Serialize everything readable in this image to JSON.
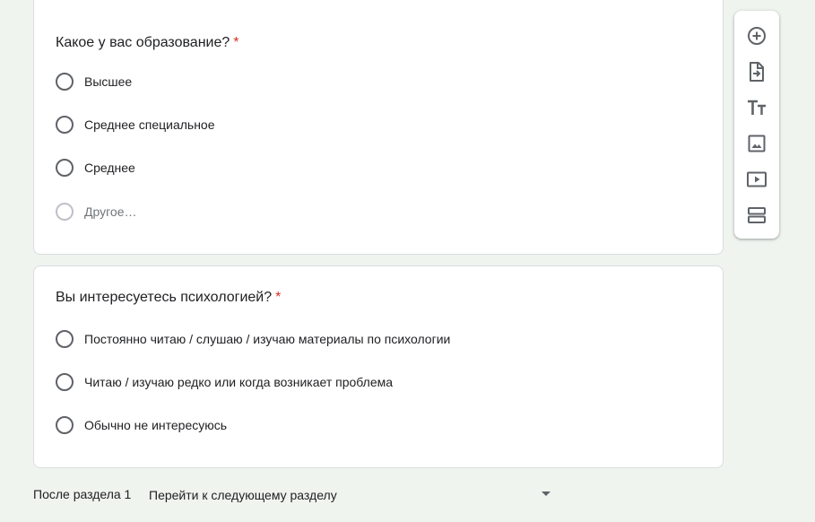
{
  "questions": [
    {
      "title": "Какое у вас образование?",
      "required_mark": "*",
      "options": [
        "Высшее",
        "Среднее специальное",
        "Среднее"
      ],
      "other_label": "Другое…"
    },
    {
      "title": "Вы интересуетесь психологией?",
      "required_mark": "*",
      "options": [
        "Постоянно читаю / слушаю / изучаю материалы по психологии",
        "Читаю / изучаю редко или когда возникает проблема",
        "Обычно не интересуюсь"
      ]
    }
  ],
  "toolbar": {
    "icons": [
      "add-question-icon",
      "import-questions-icon",
      "add-title-icon",
      "add-image-icon",
      "add-video-icon",
      "add-section-icon"
    ]
  },
  "footer": {
    "label": "После раздела 1",
    "selected": "Перейти к следующему разделу"
  },
  "colors": {
    "background": "#f0f4ef",
    "required": "#d93025",
    "icon": "#5f6368"
  }
}
